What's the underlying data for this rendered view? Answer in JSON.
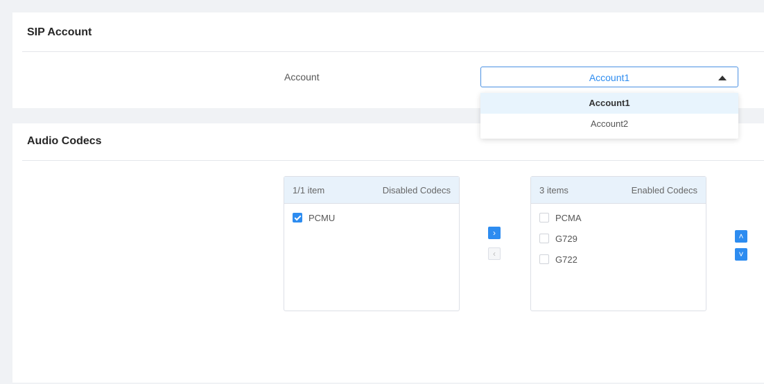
{
  "sip_account": {
    "title": "SIP Account",
    "account_label": "Account",
    "selected_value": "Account1",
    "options": [
      {
        "label": "Account1",
        "selected": true
      },
      {
        "label": "Account2",
        "selected": false
      }
    ]
  },
  "audio_codecs": {
    "title": "Audio Codecs",
    "disabled_panel": {
      "count": "1/1 item",
      "title": "Disabled Codecs",
      "items": [
        {
          "label": "PCMU",
          "checked": true
        }
      ]
    },
    "enabled_panel": {
      "count": "3 items",
      "title": "Enabled Codecs",
      "items": [
        {
          "label": "PCMA",
          "checked": false
        },
        {
          "label": "G729",
          "checked": false
        },
        {
          "label": "G722",
          "checked": false
        }
      ]
    },
    "buttons": {
      "move_right": "›",
      "move_left": "‹",
      "move_up": "˄",
      "move_down": "˅"
    }
  },
  "colors": {
    "accent": "#2d8cf0",
    "header_bg": "#e8f2fb",
    "page_bg": "#f0f2f5"
  }
}
